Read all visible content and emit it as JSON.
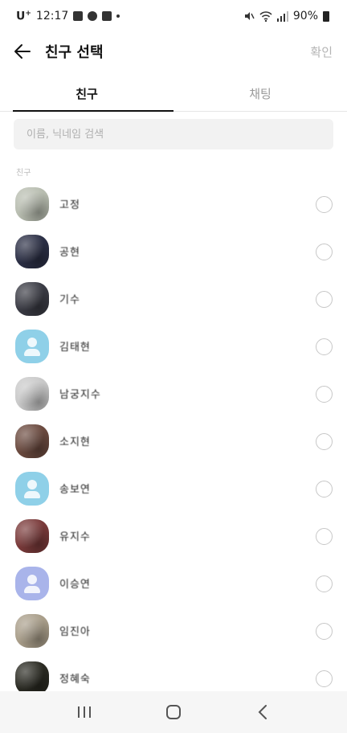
{
  "status_bar": {
    "carrier": "U",
    "carrier_sup": "+",
    "time": "12:17",
    "battery": "90%"
  },
  "header": {
    "title": "친구 선택",
    "confirm_label": "확인"
  },
  "tabs": [
    {
      "label": "친구",
      "active": true
    },
    {
      "label": "채팅",
      "active": false
    }
  ],
  "search": {
    "placeholder": "이름, 닉네임 검색",
    "value": ""
  },
  "section_label": "친구",
  "friends": [
    {
      "name": "고정",
      "avatar_color": "#b8bdb0"
    },
    {
      "name": "공현",
      "avatar_color": "#2b2f45"
    },
    {
      "name": "기수",
      "avatar_color": "#3a3b44"
    },
    {
      "name": "김태현",
      "avatar_color": "#8fd0e8",
      "default_avatar": true
    },
    {
      "name": "남궁지수",
      "avatar_color": "#c9c9c9"
    },
    {
      "name": "소지현",
      "avatar_color": "#6b4a3f"
    },
    {
      "name": "송보연",
      "avatar_color": "#8fd0e8",
      "default_avatar": true
    },
    {
      "name": "유지수",
      "avatar_color": "#7a3a3a"
    },
    {
      "name": "이승연",
      "avatar_color": "#a9b4ea",
      "default_avatar": true
    },
    {
      "name": "임진아",
      "avatar_color": "#a99e8a"
    },
    {
      "name": "정혜숙",
      "avatar_color": "#2a2a22"
    }
  ],
  "colors": {
    "accent": "#111111",
    "inactive_text": "#9a9a9a",
    "confirm_disabled": "#b5b5b5"
  }
}
